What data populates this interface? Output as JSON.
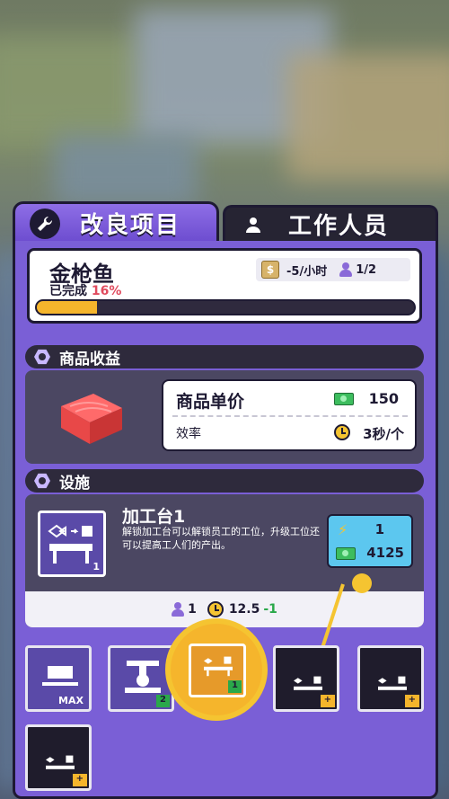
{
  "tabs": [
    {
      "label": "改良项目",
      "icon": "wrench-icon",
      "active": true
    },
    {
      "label": "工作人员",
      "icon": "person-icon",
      "active": false
    }
  ],
  "product": {
    "name": "金枪鱼",
    "completed_label": "已完成",
    "completed_pct": "16%",
    "progress": 0.16,
    "income_rate": "-5/小时",
    "staff": "1/2"
  },
  "goods_section": {
    "title": "商品收益",
    "price_label": "商品单价",
    "price_value": "150",
    "efficiency_label": "效率",
    "efficiency_value": "3秒/个"
  },
  "facility_section": {
    "title": "设施",
    "name": "加工台1",
    "description": "解锁加工台可以解锁员工的工位，升级工位还可以提高工人们的产出。",
    "thumb_level": "1",
    "upgrade_level": "1",
    "upgrade_cost": "4125",
    "footer_staff": "1",
    "footer_time": "12.5",
    "footer_delta": "-1"
  },
  "stations": [
    {
      "badge": "MAX"
    },
    {
      "badge": "2"
    },
    {
      "badge": "1",
      "selected": true
    },
    {
      "badge": "+"
    },
    {
      "badge": "+"
    },
    {
      "badge": "+"
    }
  ],
  "colors": {
    "panel_purple": "#7a5fd6",
    "accent_yellow": "#f5c431",
    "progress_orange": "#f5b52c",
    "price_green": "#3dbd5e",
    "delta_green": "#2aa84a",
    "percent_red": "#e04b5e"
  }
}
